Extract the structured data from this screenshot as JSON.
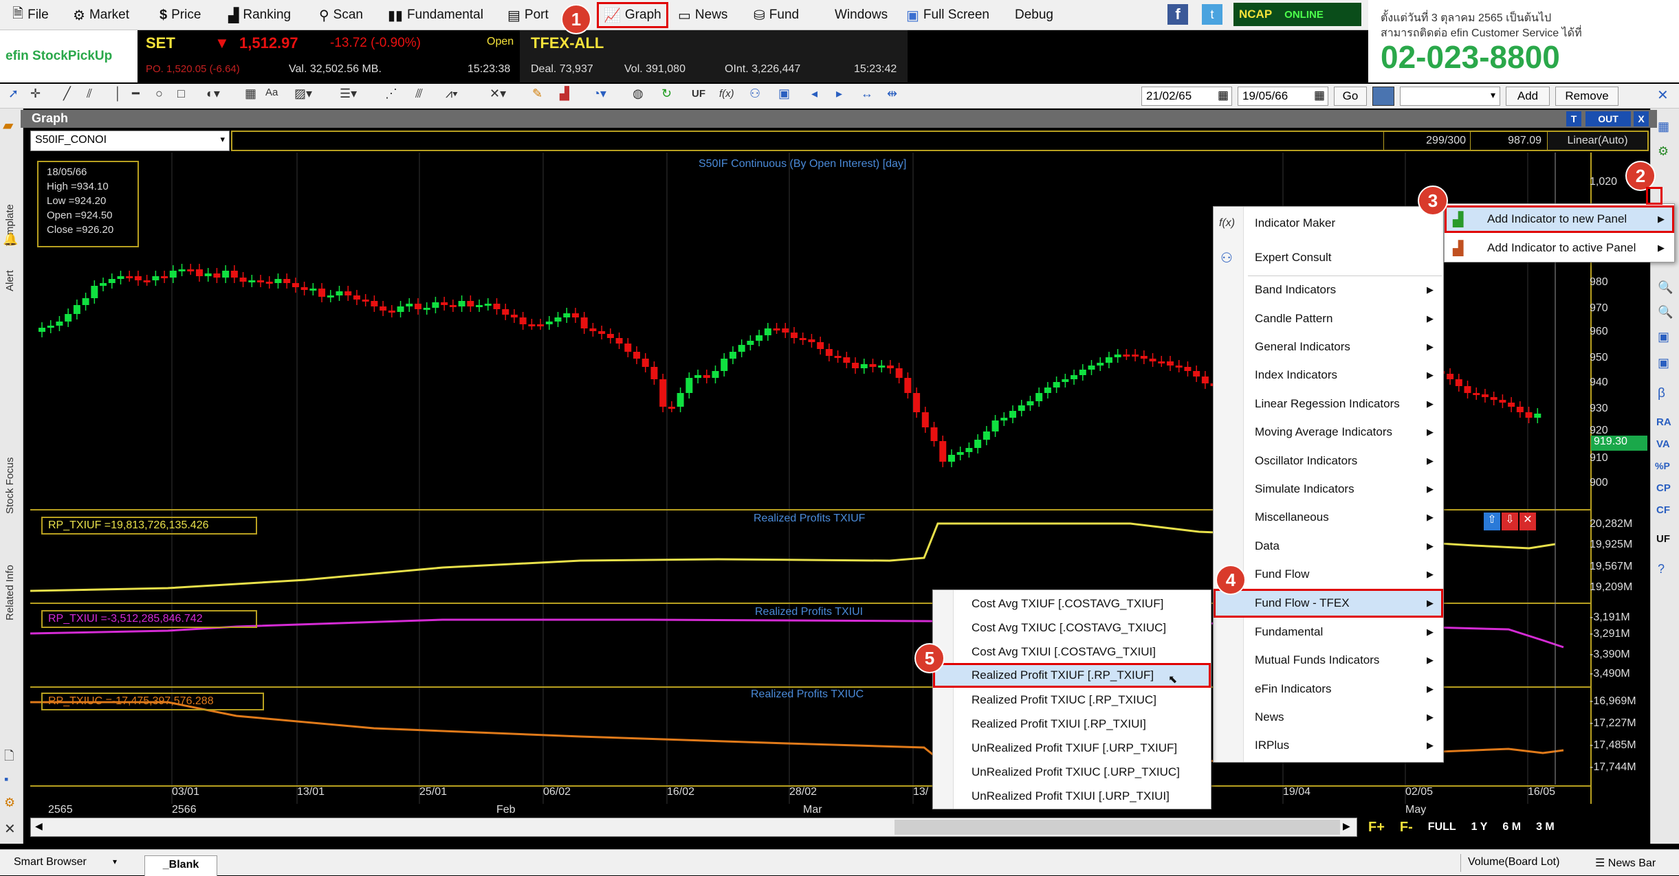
{
  "menubar": {
    "items": [
      {
        "icon": "file-icon",
        "label": "File"
      },
      {
        "icon": "market-icon",
        "label": "Market"
      },
      {
        "icon": "dollar-icon",
        "label": "Price"
      },
      {
        "icon": "ranking-icon",
        "label": "Ranking"
      },
      {
        "icon": "scan-icon",
        "label": "Scan"
      },
      {
        "icon": "fundamental-icon",
        "label": "Fundamental"
      },
      {
        "icon": "portfolio-icon",
        "label": "Port"
      },
      {
        "icon": "graph-icon",
        "label": "Graph"
      },
      {
        "icon": "news-icon",
        "label": "News"
      },
      {
        "icon": "fund-icon",
        "label": "Fund"
      },
      {
        "icon": "",
        "label": "Windows"
      },
      {
        "icon": "fullscreen-icon",
        "label": "Full Screen"
      },
      {
        "icon": "",
        "label": "Debug"
      }
    ],
    "ncap": "NCAP",
    "online": "ONLINE"
  },
  "quote": {
    "logo": "efin StockPickUp",
    "set_label": "SET",
    "set_value": "1,512.97",
    "set_change": "-13.72 (-0.90%)",
    "open_label": "Open",
    "po": "PO. 1,520.05 (-6.64)",
    "val": "Val. 32,502.56 MB.",
    "time1": "15:23:38",
    "tfex_label": "TFEX-ALL",
    "deal": "Deal. 73,937",
    "vol": "Vol. 391,080",
    "oint": "OInt. 3,226,447",
    "time2": "15:23:42"
  },
  "banner": {
    "line1": "ตั้งแต่วันที่ 3 ตุลาคม 2565 เป็นต้นไป",
    "line2": "สามารถติดต่อ efin Customer Service ได้ที่",
    "phone": "02-023-8800"
  },
  "toolbar": {
    "date_from": "21/02/65",
    "date_to": "19/05/66",
    "go": "Go",
    "add": "Add",
    "remove": "Remove"
  },
  "graph": {
    "title": "Graph",
    "symbol": "S50IF_CONOI",
    "counter": "299/300",
    "last": "987.09",
    "scale": "Linear(Auto)",
    "btn_t": "T",
    "btn_out": "OUT",
    "btn_x": "X",
    "chart_title": "S50IF Continuous (By Open Interest) [day]",
    "ohlc": {
      "date": "18/05/66",
      "high": "High =934.10",
      "low": "Low =924.20",
      "open": "Open =924.50",
      "close": "Close =926.20"
    },
    "price_label": "919.30",
    "panel1": {
      "legend": "RP_TXIUF =19,813,726,135.426",
      "title": "Realized Profits TXIUF",
      "color": "#e8e04a"
    },
    "panel2": {
      "legend": "RP_TXIUI =-3,512,285,846.742",
      "title": "Realized Profits TXIUI",
      "color": "#d42bd4"
    },
    "panel3": {
      "legend": "RP_TXIUC =-17,475,397,576.288",
      "title": "Realized Profits TXIUC",
      "color": "#e07a1a"
    },
    "yaxis_price": [
      "1,020",
      "980",
      "970",
      "960",
      "950",
      "940",
      "930",
      "920",
      "910",
      "900"
    ],
    "yaxis_p1": [
      "20,282M",
      "19,925M",
      "19,567M",
      "19,209M"
    ],
    "yaxis_p2": [
      "-3,191M",
      "-3,291M",
      "-3,390M",
      "-3,490M"
    ],
    "yaxis_p3": [
      "-16,969M",
      "-17,227M",
      "-17,485M",
      "-17,744M"
    ],
    "xaxis_top": [
      "03/01",
      "13/01",
      "25/01",
      "06/02",
      "16/02",
      "28/02",
      "13/",
      "19/04",
      "02/05",
      "16/05"
    ],
    "xaxis_bottom": [
      "2565",
      "2566",
      "Feb",
      "Mar",
      "May"
    ],
    "scroll_buttons": [
      "F+",
      "F-",
      "FULL",
      "1 Y",
      "6 M",
      "3 M"
    ]
  },
  "left_tabs": [
    "Template",
    "Alert",
    "Stock Focus",
    "Related Info"
  ],
  "right_tools": [
    "RA",
    "VA",
    "%P",
    "CP",
    "CF",
    "UF",
    "β"
  ],
  "context_menu": {
    "items": [
      {
        "label": "Indicator Maker",
        "icon": "indicator-maker-icon",
        "arrow": false
      },
      {
        "label": "Expert Consult",
        "icon": "expert-icon",
        "arrow": false
      },
      {
        "label": "Band Indicators",
        "arrow": true
      },
      {
        "label": "Candle Pattern",
        "arrow": true
      },
      {
        "label": "General Indicators",
        "arrow": true
      },
      {
        "label": "Index Indicators",
        "arrow": true
      },
      {
        "label": "Linear Regession Indicators",
        "arrow": true
      },
      {
        "label": "Moving Average Indicators",
        "arrow": true
      },
      {
        "label": "Oscillator Indicators",
        "arrow": true
      },
      {
        "label": "Simulate Indicators",
        "arrow": true
      },
      {
        "label": "Miscellaneous",
        "arrow": true
      },
      {
        "label": "Data",
        "arrow": true
      },
      {
        "label": "Fund Flow",
        "arrow": true
      },
      {
        "label": "Fund Flow - TFEX",
        "arrow": true
      },
      {
        "label": "Fundamental",
        "arrow": true
      },
      {
        "label": "Mutual Funds Indicators",
        "arrow": true
      },
      {
        "label": "eFin Indicators",
        "arrow": true
      },
      {
        "label": "News",
        "arrow": true
      },
      {
        "label": "IRPlus",
        "arrow": true
      }
    ]
  },
  "panel_menu": {
    "items": [
      {
        "label": "Add Indicator to new Panel"
      },
      {
        "label": "Add Indicator to active Panel"
      }
    ]
  },
  "sub_menu": {
    "items": [
      "Cost Avg TXIUF [.COSTAVG_TXIUF]",
      "Cost Avg TXIUC [.COSTAVG_TXIUC]",
      "Cost Avg TXIUI [.COSTAVG_TXIUI]",
      "Realized Profit TXIUF [.RP_TXIUF]",
      "Realized Profit TXIUC [.RP_TXIUC]",
      "Realized Profit TXIUI [.RP_TXIUI]",
      "UnRealized Profit TXIUF [.URP_TXIUF]",
      "UnRealized Profit TXIUC [.URP_TXIUC]",
      "UnRealized Profit TXIUI [.URP_TXIUI]"
    ]
  },
  "badges": [
    "1",
    "2",
    "3",
    "4",
    "5"
  ],
  "statusbar": {
    "smart_browser": "Smart Browser",
    "tab": "_Blank",
    "volume": "Volume(Board Lot)",
    "newsbar": "News Bar"
  },
  "colors": {
    "up": "#10e040",
    "down": "#e81010",
    "highlight": "#e00000"
  }
}
